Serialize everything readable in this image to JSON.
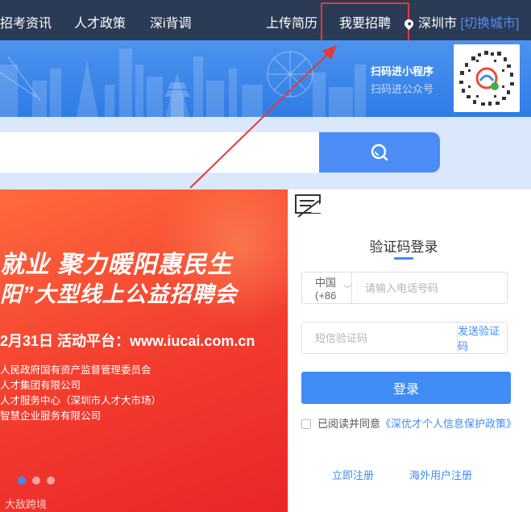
{
  "nav": {
    "items": [
      "招考资讯",
      "人才政策",
      "深i背调",
      "上传简历",
      "我要招聘"
    ],
    "city": "深圳市",
    "switch_city": "[切换城市]"
  },
  "banner": {
    "qr_mini_program": "扫码进小程序",
    "qr_official_account": "扫码进公众号"
  },
  "search": {
    "placeholder": "",
    "icon": "search-icon"
  },
  "promo": {
    "line1": "就业 聚力暖阳惠民生",
    "line2": "阳”大型线上公益招聘会",
    "line3": "2月31日  活动平台：www.iucai.com.cn",
    "orgs": [
      "人民政府国有资产监督管理委员会",
      "人才集团有限公司",
      "人才服务中心（深圳市人才大市场）",
      "智慧企业服务有限公司"
    ],
    "watermark": "大敌跨境",
    "carousel_count": 3,
    "carousel_active": 0
  },
  "login": {
    "title": "验证码登录",
    "country_code": "中国(+86",
    "phone_placeholder": "请输入电话号码",
    "code_placeholder": "短信验证码",
    "send_code": "发送验证码",
    "login_button": "登录",
    "agree_text": "已阅读并同意",
    "policy_link": "《深优才个人信息保护政策》",
    "register": "立即注册",
    "overseas_register": "海外用户注册"
  },
  "colors": {
    "nav_bg": "#2b3a55",
    "primary": "#3f8cf5",
    "highlight": "#e53935",
    "promo_red": "#f23b2e"
  }
}
